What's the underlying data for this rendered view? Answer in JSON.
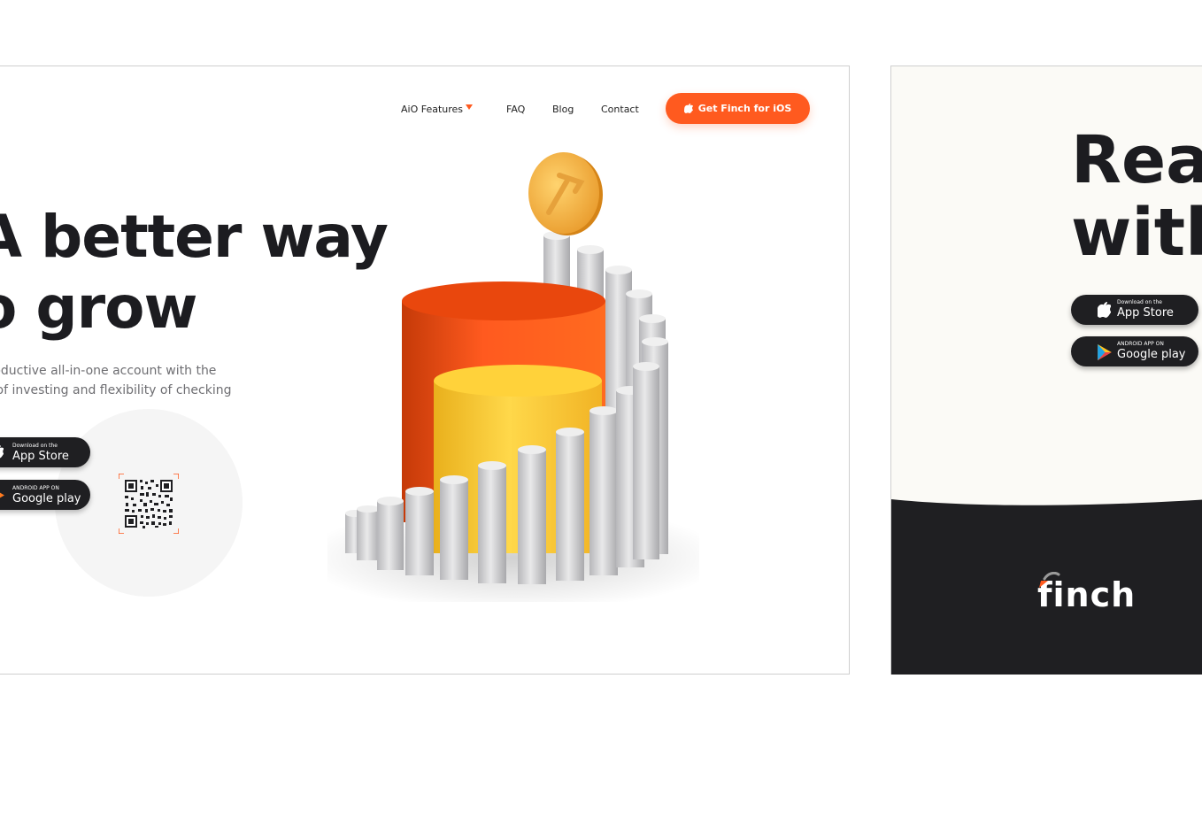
{
  "nav": {
    "features_label": "AiO Features",
    "faq_label": "FAQ",
    "blog_label": "Blog",
    "contact_label": "Contact",
    "cta_label": "Get Finch for iOS"
  },
  "hero": {
    "title_line1": "A better way",
    "title_line2": "o grow",
    "subtitle_line1": "productive all-in-one account with the",
    "subtitle_line2": "rs of investing and flexibility of checking"
  },
  "stores": {
    "appstore_small": "Download on the",
    "appstore_big": "App Store",
    "googleplay_small": "ANDROID APP ON",
    "googleplay_big": "Google play"
  },
  "right_panel": {
    "title_line1": "Read",
    "title_line2": "with",
    "logo_text": "finch"
  },
  "colors": {
    "accent": "#ff5a1f",
    "dark": "#1f1f22",
    "cream": "#fbfaf6"
  }
}
